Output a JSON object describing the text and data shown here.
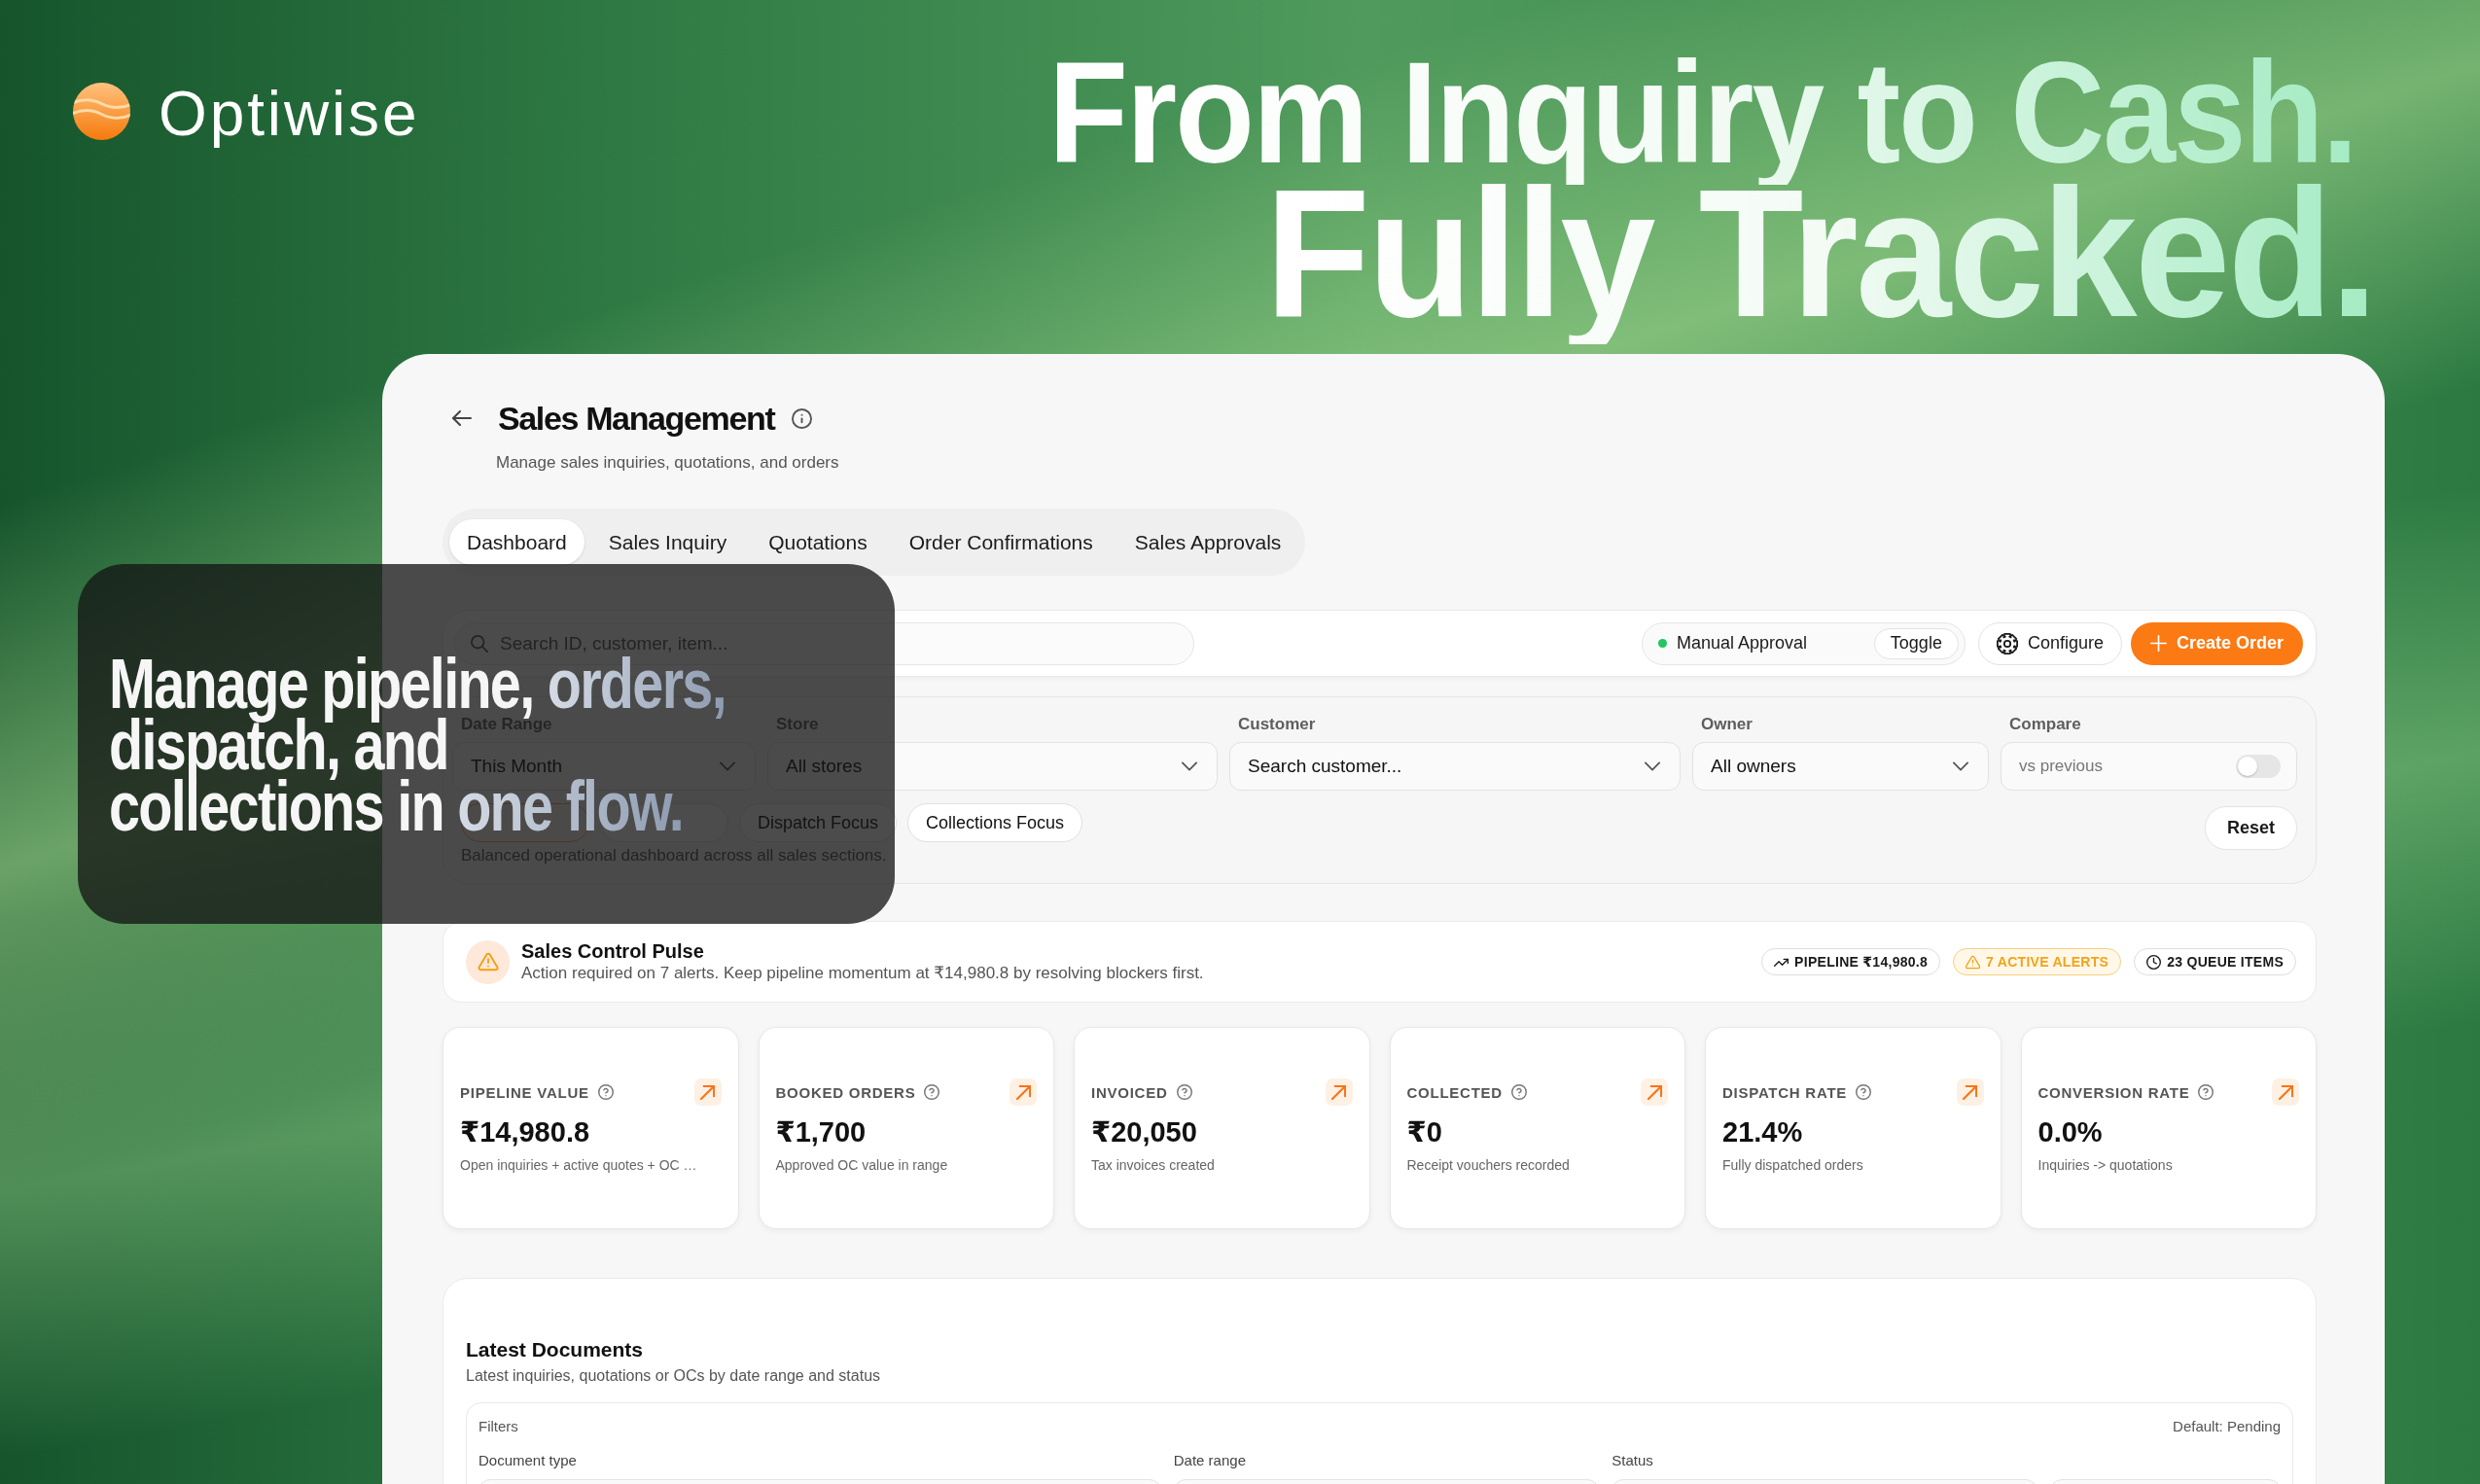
{
  "brand": {
    "name": "Optiwise"
  },
  "hero": {
    "lines": [
      "From Inquiry to Cash.",
      "Fully Tracked."
    ]
  },
  "promo": {
    "lines": [
      [
        {
          "text": "Manage pipeline, ",
          "accent": false
        },
        {
          "text": "orders,",
          "accent": true
        }
      ],
      [
        {
          "text": "dispatch, and",
          "accent": false
        }
      ],
      [
        {
          "text": "collections in ",
          "accent": false
        },
        {
          "text": "one flow.",
          "accent": true
        }
      ]
    ]
  },
  "header": {
    "title": "Sales Management",
    "subtitle": "Manage sales inquiries, quotations, and orders"
  },
  "tabs": [
    {
      "label": "Dashboard",
      "selected": true
    },
    {
      "label": "Sales Inquiry",
      "selected": false
    },
    {
      "label": "Quotations",
      "selected": false
    },
    {
      "label": "Order Confirmations",
      "selected": false
    },
    {
      "label": "Sales Approvals",
      "selected": false
    }
  ],
  "toolbar": {
    "search": {
      "placeholder": "Search ID, customer, item..."
    },
    "approval": {
      "label": "Manual Approval",
      "active": true,
      "action": "Toggle"
    },
    "buttons": [
      {
        "label": "Configure",
        "kind": "secondary"
      },
      {
        "label": "Create Order",
        "kind": "primary"
      }
    ]
  },
  "filters": {
    "fields": [
      {
        "label": "Date Range",
        "value": "This Month",
        "kind": "select"
      },
      {
        "label": "Store",
        "value": "All stores",
        "kind": "select"
      },
      {
        "label": "Customer",
        "value": "Search customer...",
        "kind": "select"
      },
      {
        "label": "Owner",
        "value": "All owners",
        "kind": "select"
      },
      {
        "label": "Compare",
        "value": "vs previous",
        "kind": "toggle",
        "on": false
      }
    ],
    "presets": [
      {
        "selected": true
      },
      {
        "selected": false
      },
      {
        "label": "Dispatch Focus",
        "selected": false
      },
      {
        "label": "Collections Focus",
        "selected": false
      }
    ],
    "description": "Balanced operational dashboard across all sales sections.",
    "reset": "Reset"
  },
  "pulse": {
    "title": "Sales Control Pulse",
    "message": "Action required on 7 alerts. Keep pipeline momentum at ₹14,980.8 by resolving blockers first.",
    "badges": [
      {
        "label": "PIPELINE ₹14,980.8",
        "kind": "trend"
      },
      {
        "label": "7 ACTIVE ALERTS",
        "kind": "alert"
      },
      {
        "label": "23 QUEUE ITEMS",
        "kind": "queue"
      }
    ]
  },
  "kpis": [
    {
      "label": "PIPELINE VALUE",
      "value": "₹14,980.8",
      "note": "Open inquiries + active quotes + OC …"
    },
    {
      "label": "BOOKED ORDERS",
      "value": "₹1,700",
      "note": "Approved OC value in range"
    },
    {
      "label": "INVOICED",
      "value": "₹20,050",
      "note": "Tax invoices created"
    },
    {
      "label": "COLLECTED",
      "value": "₹0",
      "note": "Receipt vouchers recorded"
    },
    {
      "label": "DISPATCH RATE",
      "value": "21.4%",
      "note": "Fully dispatched orders"
    },
    {
      "label": "CONVERSION RATE",
      "value": "0.0%",
      "note": "Inquiries -> quotations"
    }
  ],
  "documents": {
    "title": "Latest Documents",
    "subtitle": "Latest inquiries, quotations or OCs by date range and status",
    "filters_title": "Filters",
    "default_note": "Default: Pending",
    "fields": [
      {
        "label": "Document type",
        "kind": "labeled"
      },
      {
        "label": "Date range",
        "kind": "labeled"
      },
      {
        "label": "Status",
        "kind": "labeled"
      },
      {
        "kind": "blank"
      }
    ]
  }
}
